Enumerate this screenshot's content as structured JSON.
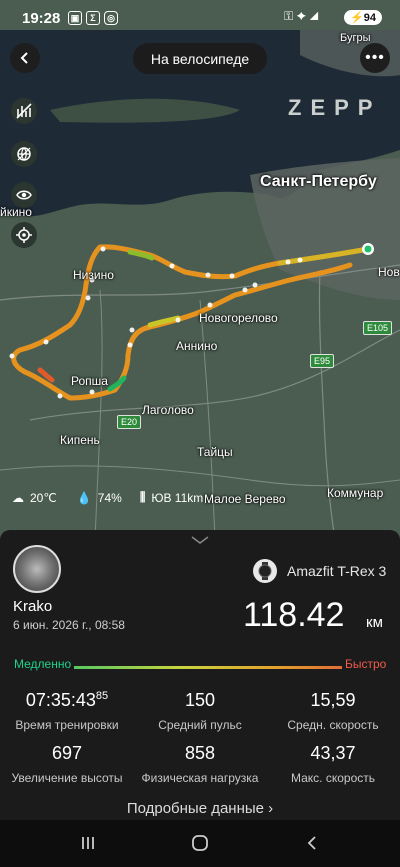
{
  "status": {
    "time": "19:28",
    "battery": "94"
  },
  "header": {
    "activity": "На велосипеде"
  },
  "map": {
    "brand": "ZEPP",
    "places": {
      "spb": "Санкт-Петербу",
      "kino": "йкино",
      "nizino": "Низино",
      "novogorelovo": "Новогорелово",
      "annino": "Аннино",
      "ropsha": "Ропша",
      "lagolovo": "Лаголово",
      "kipen": "Кипень",
      "taitsy": "Тайцы",
      "malo_verevo": "Малое Верево",
      "kommunar": "Коммунар",
      "bugry": "Бугры",
      "nov": "Нов"
    },
    "highways": {
      "e105": "E105",
      "e95": "E95",
      "e20": "E20"
    },
    "weather": {
      "temp": "20℃",
      "humidity": "74%",
      "wind": "ЮВ 11km"
    }
  },
  "summary": {
    "user": {
      "name": "Krako",
      "date": "6 июн. 2026 г., 08:58"
    },
    "device": "Amazfit T-Rex 3",
    "distance": "118.42",
    "distance_unit": "км",
    "speed_scale": {
      "slow": "Медленно",
      "fast": "Быстро"
    },
    "stats": [
      {
        "value": "07:35:43",
        "extra": "85",
        "label": "Время тренировки"
      },
      {
        "value": "150",
        "label": "Средний пульс"
      },
      {
        "value": "15,59",
        "label": "Средн. скорость"
      },
      {
        "value": "697",
        "label": "Увеличение высоты"
      },
      {
        "value": "858",
        "label": "Физическая нагрузка"
      },
      {
        "value": "43,37",
        "label": "Макс. скорость"
      }
    ],
    "details_link": "Подробные данные ›"
  }
}
